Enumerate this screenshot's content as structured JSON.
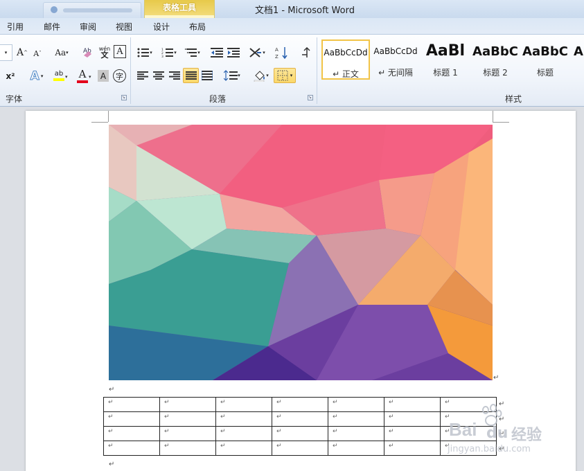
{
  "window": {
    "title": "文档1 - Microsoft Word",
    "context_group": "表格工具"
  },
  "ribbon_tabs": [
    {
      "label": "引用"
    },
    {
      "label": "邮件"
    },
    {
      "label": "审阅"
    },
    {
      "label": "视图"
    },
    {
      "label": "设计"
    },
    {
      "label": "布局"
    }
  ],
  "font_group": {
    "label": "字体",
    "grow_font": "A",
    "shrink_font": "A",
    "change_case": "Aa",
    "clear_format": "A",
    "phonetic": "wén",
    "char_border": "A",
    "superscript": "x²",
    "text_effect": "A",
    "highlight": "ab",
    "font_color": "A",
    "char_shading": "A",
    "enclose": "字"
  },
  "paragraph_group": {
    "label": "段落"
  },
  "styles_group": {
    "label": "样式",
    "items": [
      {
        "sample": "AaBbCcDd",
        "name": "↵ 正文"
      },
      {
        "sample": "AaBbCcDd",
        "name": "↵ 无间隔"
      },
      {
        "sample": "AaBl",
        "name": "标题 1"
      },
      {
        "sample": "AaBbC",
        "name": "标题 2"
      },
      {
        "sample": "AaBbC",
        "name": "标题"
      },
      {
        "sample": "A",
        "name": ""
      }
    ]
  },
  "document": {
    "paragraph_mark": "↵",
    "table": {
      "rows": 4,
      "cols": 7,
      "cell_mark": "↵"
    }
  },
  "watermark": {
    "brand": "Bai",
    "brand_suffix": "经验",
    "url": "jingyan.baidu.com"
  },
  "colors": {
    "accent_selected": "#fbd86a",
    "context_tab": "#e7c94a"
  }
}
